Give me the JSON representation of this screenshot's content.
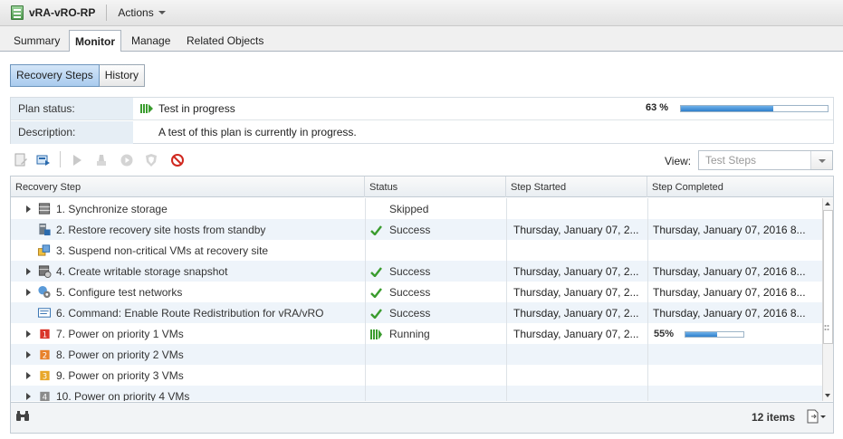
{
  "header": {
    "title": "vRA-vRO-RP",
    "actions_label": "Actions"
  },
  "tabs": [
    {
      "label": "Summary",
      "active": false
    },
    {
      "label": "Monitor",
      "active": true
    },
    {
      "label": "Manage",
      "active": false
    },
    {
      "label": "Related Objects",
      "active": false
    }
  ],
  "subtabs": [
    {
      "label": "Recovery Steps",
      "active": true
    },
    {
      "label": "History",
      "active": false
    }
  ],
  "plan": {
    "status_label": "Plan status:",
    "status_value": "Test in progress",
    "progress_text": "63 %",
    "progress": 0.63,
    "description_label": "Description:",
    "description_value": "A test of this plan is currently in progress."
  },
  "toolbar": {
    "icons": [
      "edit-plan-icon",
      "run-test-icon",
      "recovery-icon",
      "cleanup-icon",
      "reprotect-icon",
      "shield-icon",
      "cancel-icon"
    ],
    "view_label": "View:",
    "view_value": "Test Steps"
  },
  "grid": {
    "columns": [
      "Recovery Step",
      "Status",
      "Step Started",
      "Step Completed"
    ],
    "rows": [
      {
        "step": "1. Synchronize storage",
        "status": "Skipped",
        "status_icon": "",
        "started": "",
        "completed": "",
        "expandable": true,
        "icon": "storage-icon"
      },
      {
        "step": "2. Restore recovery site hosts from standby",
        "status": "Success",
        "status_icon": "check-icon",
        "started": "Thursday, January 07, 2...",
        "completed": "Thursday, January 07, 2016 8...",
        "expandable": false,
        "icon": "host-icon"
      },
      {
        "step": "3. Suspend non-critical VMs at recovery site",
        "status": "",
        "status_icon": "",
        "started": "",
        "completed": "",
        "expandable": false,
        "icon": "suspend-vms-icon"
      },
      {
        "step": "4. Create writable storage snapshot",
        "status": "Success",
        "status_icon": "check-icon",
        "started": "Thursday, January 07, 2...",
        "completed": "Thursday, January 07, 2016 8...",
        "expandable": true,
        "icon": "snapshot-icon"
      },
      {
        "step": "5. Configure test networks",
        "status": "Success",
        "status_icon": "check-icon",
        "started": "Thursday, January 07, 2...",
        "completed": "Thursday, January 07, 2016 8...",
        "expandable": true,
        "icon": "network-icon"
      },
      {
        "step": "6. Command: Enable Route Redistribution for vRA/vRO",
        "status": "Success",
        "status_icon": "check-icon",
        "started": "Thursday, January 07, 2...",
        "completed": "Thursday, January 07, 2016 8...",
        "expandable": false,
        "icon": "command-icon"
      },
      {
        "step": "7. Power on priority 1 VMs",
        "status": "Running",
        "status_icon": "running-icon",
        "started": "Thursday, January 07, 2...",
        "completed": "",
        "progress_text": "55%",
        "progress": 0.55,
        "expandable": true,
        "icon": "priority-1-icon"
      },
      {
        "step": "8. Power on priority 2 VMs",
        "status": "",
        "status_icon": "",
        "started": "",
        "completed": "",
        "expandable": true,
        "icon": "priority-2-icon"
      },
      {
        "step": "9. Power on priority 3 VMs",
        "status": "",
        "status_icon": "",
        "started": "",
        "completed": "",
        "expandable": true,
        "icon": "priority-3-icon"
      },
      {
        "step": "10. Power on priority 4 VMs",
        "status": "",
        "status_icon": "",
        "started": "",
        "completed": "",
        "expandable": true,
        "icon": "priority-4-icon"
      }
    ],
    "items_count": "12 items"
  },
  "colors": {
    "accent": "#2f7fcc",
    "success": "#3a9c2e",
    "running": "#3a9c2e",
    "alt_row": "#eef4fa",
    "priority_1": "#d9352a",
    "priority_2": "#e8812a",
    "priority_3": "#e8a72a",
    "priority_4": "#8a8a8a"
  }
}
